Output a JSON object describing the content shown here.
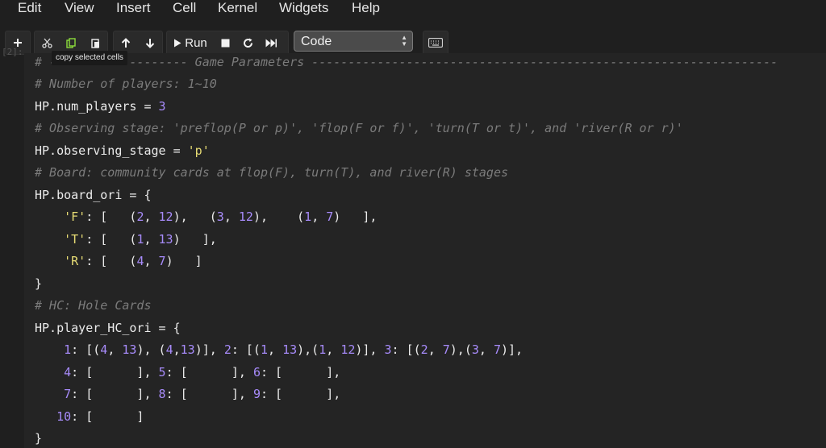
{
  "menubar": {
    "items": [
      "Edit",
      "View",
      "Insert",
      "Cell",
      "Kernel",
      "Widgets",
      "Help"
    ]
  },
  "toolbar": {
    "add_icon": "plus-icon",
    "cut_icon": "scissors-icon",
    "copy_icon": "copy-icon",
    "paste_icon": "paste-icon",
    "move_up_icon": "arrow-up-icon",
    "move_down_icon": "arrow-down-icon",
    "run_label": "Run",
    "stop_icon": "stop-icon",
    "restart_icon": "restart-icon",
    "run_all_icon": "fast-forward-icon",
    "cell_type": "Code",
    "keyboard_icon": "keyboard-icon",
    "tooltip": "copy selected cells"
  },
  "cell": {
    "prompt_fragment": "[2]:",
    "lines": [
      [
        [
          "cm",
          "# ------------------- Game Parameters ----------------------------------------------------------------"
        ]
      ],
      [
        [
          "cm",
          "# Number of players: 1~10"
        ]
      ],
      [
        [
          "op",
          "HP.num_players = "
        ],
        [
          "num",
          "3"
        ]
      ],
      [
        [
          "cm",
          "# Observing stage: 'preflop(P or p)', 'flop(F or f)', 'turn(T or t)', and 'river(R or r)'"
        ]
      ],
      [
        [
          "op",
          "HP.observing_stage = "
        ],
        [
          "str",
          "'p'"
        ]
      ],
      [
        [
          "cm",
          "# Board: community cards at flop(F), turn(T), and river(R) stages"
        ]
      ],
      [
        [
          "op",
          "HP.board_ori = {"
        ]
      ],
      [
        [
          "op",
          "    "
        ],
        [
          "str",
          "'F'"
        ],
        [
          "op",
          ": [   ("
        ],
        [
          "num",
          "2"
        ],
        [
          "op",
          ", "
        ],
        [
          "num",
          "12"
        ],
        [
          "op",
          "),   ("
        ],
        [
          "num",
          "3"
        ],
        [
          "op",
          ", "
        ],
        [
          "num",
          "12"
        ],
        [
          "op",
          "),    ("
        ],
        [
          "num",
          "1"
        ],
        [
          "op",
          ", "
        ],
        [
          "num",
          "7"
        ],
        [
          "op",
          ")   ],"
        ]
      ],
      [
        [
          "op",
          "    "
        ],
        [
          "str",
          "'T'"
        ],
        [
          "op",
          ": [   ("
        ],
        [
          "num",
          "1"
        ],
        [
          "op",
          ", "
        ],
        [
          "num",
          "13"
        ],
        [
          "op",
          ")   ],"
        ]
      ],
      [
        [
          "op",
          "    "
        ],
        [
          "str",
          "'R'"
        ],
        [
          "op",
          ": [   ("
        ],
        [
          "num",
          "4"
        ],
        [
          "op",
          ", "
        ],
        [
          "num",
          "7"
        ],
        [
          "op",
          ")   ]"
        ]
      ],
      [
        [
          "op",
          "}"
        ]
      ],
      [
        [
          "cm",
          "# HC: Hole Cards"
        ]
      ],
      [
        [
          "op",
          "HP.player_HC_ori = {"
        ]
      ],
      [
        [
          "op",
          "    "
        ],
        [
          "num",
          "1"
        ],
        [
          "op",
          ": [("
        ],
        [
          "num",
          "4"
        ],
        [
          "op",
          ", "
        ],
        [
          "num",
          "13"
        ],
        [
          "op",
          "), ("
        ],
        [
          "num",
          "4"
        ],
        [
          "op",
          ","
        ],
        [
          "num",
          "13"
        ],
        [
          "op",
          ")], "
        ],
        [
          "num",
          "2"
        ],
        [
          "op",
          ": [("
        ],
        [
          "num",
          "1"
        ],
        [
          "op",
          ", "
        ],
        [
          "num",
          "13"
        ],
        [
          "op",
          "),("
        ],
        [
          "num",
          "1"
        ],
        [
          "op",
          ", "
        ],
        [
          "num",
          "12"
        ],
        [
          "op",
          ")], "
        ],
        [
          "num",
          "3"
        ],
        [
          "op",
          ": [("
        ],
        [
          "num",
          "2"
        ],
        [
          "op",
          ", "
        ],
        [
          "num",
          "7"
        ],
        [
          "op",
          "),("
        ],
        [
          "num",
          "3"
        ],
        [
          "op",
          ", "
        ],
        [
          "num",
          "7"
        ],
        [
          "op",
          ")],"
        ]
      ],
      [
        [
          "op",
          "    "
        ],
        [
          "num",
          "4"
        ],
        [
          "op",
          ": [      ], "
        ],
        [
          "num",
          "5"
        ],
        [
          "op",
          ": [      ], "
        ],
        [
          "num",
          "6"
        ],
        [
          "op",
          ": [      ],"
        ]
      ],
      [
        [
          "op",
          "    "
        ],
        [
          "num",
          "7"
        ],
        [
          "op",
          ": [      ], "
        ],
        [
          "num",
          "8"
        ],
        [
          "op",
          ": [      ], "
        ],
        [
          "num",
          "9"
        ],
        [
          "op",
          ": [      ],"
        ]
      ],
      [
        [
          "op",
          "   "
        ],
        [
          "num",
          "10"
        ],
        [
          "op",
          ": [      ]"
        ]
      ],
      [
        [
          "op",
          "}"
        ]
      ]
    ]
  }
}
